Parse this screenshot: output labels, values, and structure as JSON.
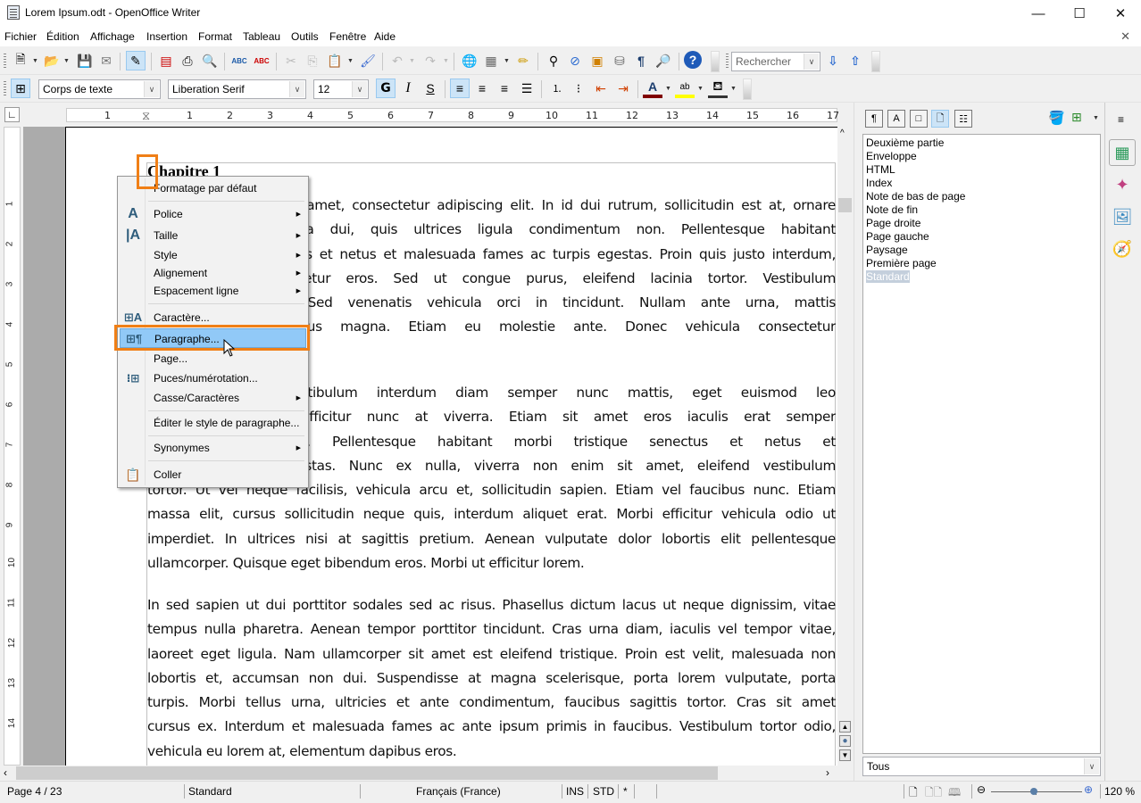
{
  "window": {
    "title": "Lorem Ipsum.odt - OpenOffice Writer",
    "controls": {
      "minimize": "—",
      "maximize": "☐",
      "close": "✕"
    },
    "doc_close": "✕"
  },
  "menubar": [
    "Fichier",
    "Édition",
    "Affichage",
    "Insertion",
    "Format",
    "Tableau",
    "Outils",
    "Fenêtre",
    "Aide"
  ],
  "toolbar_standard": {
    "icons": [
      "new-document",
      "open-folder",
      "save",
      "email-document",
      "edit-mode",
      "export-pdf",
      "print",
      "print-preview",
      "spellcheck",
      "auto-spellcheck",
      "cut",
      "copy",
      "paste",
      "clone-formatting",
      "undo",
      "redo",
      "hyperlink",
      "table",
      "show-draw-functions",
      "find-replace",
      "navigator",
      "gallery",
      "data-sources",
      "nonprinting-characters",
      "zoom",
      "help"
    ],
    "search_placeholder": "Rechercher"
  },
  "toolbar_formatting": {
    "paragraph_style": "Corps de texte",
    "font_name": "Liberation Serif",
    "font_size": "12",
    "bold_label": "G",
    "italic_label": "I",
    "shadow_label": "S",
    "font_color": "#800000",
    "highlight_color": "#ffff00"
  },
  "ruler": {
    "horizontal_ticks": [
      "1",
      "1",
      "2",
      "3",
      "4",
      "5",
      "6",
      "7",
      "8",
      "9",
      "10",
      "11",
      "12",
      "13",
      "14",
      "15",
      "16",
      "17"
    ],
    "vertical_ticks": [
      "1",
      "2",
      "3",
      "4",
      "5",
      "6",
      "7",
      "8",
      "9",
      "10",
      "11",
      "12",
      "13",
      "14"
    ]
  },
  "document": {
    "heading": "Chapitre 1",
    "para1": [
      "Lorem ipsum dolor sit amet, consectetur adipiscing elit. In id dui rutrum, sollicitudin est at, ornare",
      "nisl. Vestibulum ligula dui, quis ultrices ligula condimentum non. Pellentesque habitant",
      "morbi tristique senectus et netus et malesuada fames ac turpis egestas. Proin quis justo interdum,",
      "aliquam nisl consectetur eros. Sed ut congue purus, eleifend lacinia tortor. Vestibulum",
      "id elit sed auctor. Sed venenatis vehicula orci in tincidunt. Nullam ante urna, mattis",
      "ac fermentum tempus magna. Etiam eu molestie ante. Donec vehicula consectetur"
    ],
    "para2": [
      "Aliquam neque. Vestibulum interdum diam semper nunc mattis, eget euismod leo",
      "sagittis. Sollicitudin efficitur nunc at viverra. Etiam sit amet eros iaculis erat semper",
      "in sit amet enim. Pellentesque habitant morbi tristique senectus et netus et",
      "fames ac turpis egestas. Nunc ex nulla, viverra non enim sit amet, eleifend vestibulum",
      "tortor. Ut vel neque facilisis, vehicula arcu et, sollicitudin sapien. Etiam vel faucibus nunc. Etiam",
      "massa elit, cursus sollicitudin neque quis, interdum aliquet erat. Morbi efficitur vehicula odio ut",
      "imperdiet. In ultrices nisi at sagittis pretium. Aenean vulputate dolor lobortis elit pellentesque",
      "ullamcorper. Quisque eget bibendum eros. Morbi ut efficitur lorem."
    ],
    "para3": [
      "In sed sapien ut dui porttitor sodales sed ac risus. Phasellus dictum lacus ut neque dignissim, vitae",
      "tempus nulla pharetra. Aenean tempor porttitor tincidunt. Cras urna diam, iaculis vel tempor vitae,",
      "laoreet eget ligula. Nam ullamcorper sit amet est eleifend tristique. Proin est velit, malesuada non",
      "lobortis et, accumsan non dui. Suspendisse at magna scelerisque, porta lorem vulputate, porta",
      "turpis. Morbi tellus urna, ultricies et ante condimentum, faucibus sagittis tortor. Cras sit amet",
      "cursus ex. Interdum et malesuada fames ac ante ipsum primis in faucibus. Vestibulum tortor odio,",
      "vehicula eu lorem at, elementum dapibus eros."
    ]
  },
  "context_menu": {
    "items": [
      {
        "label": "Formatage par défaut",
        "icon": null,
        "submenu": false
      },
      {
        "label": "Police",
        "icon": "font-icon",
        "submenu": true
      },
      {
        "label": "Taille",
        "icon": "font-size-icon",
        "submenu": true
      },
      {
        "label": "Style",
        "icon": null,
        "submenu": true
      },
      {
        "label": "Alignement",
        "icon": null,
        "submenu": true
      },
      {
        "label": "Espacement ligne",
        "icon": null,
        "submenu": true
      },
      {
        "label": "Caractère...",
        "icon": "character-icon",
        "submenu": false
      },
      {
        "label": "Paragraphe...",
        "icon": "paragraph-icon",
        "submenu": false,
        "highlighted": true
      },
      {
        "label": "Page...",
        "icon": null,
        "submenu": false
      },
      {
        "label": "Puces/numérotation...",
        "icon": "bullets-icon",
        "submenu": false
      },
      {
        "label": "Casse/Caractères",
        "icon": null,
        "submenu": true
      },
      {
        "label": "Éditer le style de paragraphe...",
        "icon": null,
        "submenu": false
      },
      {
        "label": "Synonymes",
        "icon": null,
        "submenu": true
      },
      {
        "label": "Coller",
        "icon": "paste-icon",
        "submenu": false
      }
    ],
    "highlight_color": "#f07f16"
  },
  "styles_panel": {
    "category_icons": [
      "paragraph-styles",
      "character-styles",
      "frame-styles",
      "page-styles",
      "list-styles"
    ],
    "active_category": "page-styles",
    "items": [
      "Deuxième partie",
      "Enveloppe",
      "HTML",
      "Index",
      "Note de bas de page",
      "Note de fin",
      "Page droite",
      "Page gauche",
      "Paysage",
      "Première page",
      "Standard"
    ],
    "selected": "Standard",
    "filter": "Tous"
  },
  "deck_icons": [
    "properties",
    "styles-and-formatting",
    "gallery",
    "navigator"
  ],
  "statusbar": {
    "page": "Page 4 / 23",
    "page_style": "Standard",
    "language": "Français (France)",
    "insert_mode": "INS",
    "selection_mode": "STD",
    "modified": "*",
    "zoom": "120 %",
    "zoom_level_percent": 120
  }
}
